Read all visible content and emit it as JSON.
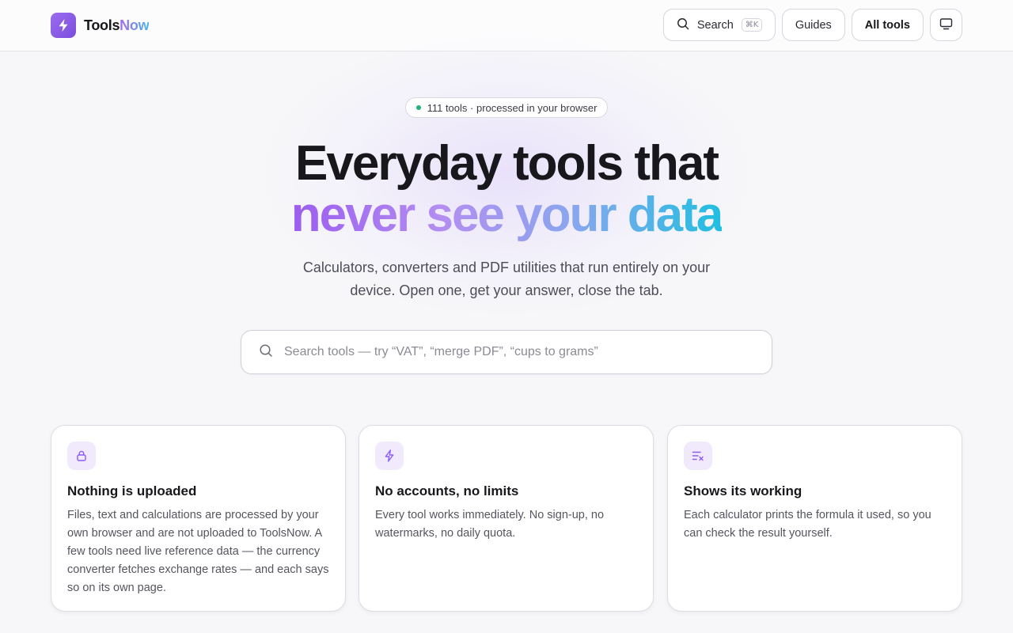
{
  "brand": {
    "name_part1": "Tools",
    "name_part2": "Now"
  },
  "nav": {
    "search_label": "Search",
    "search_shortcut": "⌘K",
    "guides_label": "Guides",
    "all_tools_label": "All tools"
  },
  "hero": {
    "badge": "111 tools · processed in your browser",
    "headline_line1": "Everyday tools that",
    "headline_line2": "never see your data",
    "subtitle": "Calculators, converters and PDF utilities that run entirely on your device. Open one, get your answer, close the tab."
  },
  "search": {
    "placeholder": "Search tools — try “VAT”, “merge PDF”, “cups to grams”",
    "value": ""
  },
  "features": [
    {
      "icon": "lock-icon",
      "title": "Nothing is uploaded",
      "body": "Files, text and calculations are processed by your own browser and are not uploaded to ToolsNow. A few tools need live reference data — the currency converter fetches exchange rates — and each says so on its own page."
    },
    {
      "icon": "bolt-icon",
      "title": "No accounts, no limits",
      "body": "Every tool works immediately. No sign-up, no watermarks, no daily quota."
    },
    {
      "icon": "formula-icon",
      "title": "Shows its working",
      "body": "Each calculator prints the formula it used, so you can check the result yourself."
    }
  ],
  "colors": {
    "accent": "#8b5cf6",
    "accent_light": "#f1eafd",
    "gradient_start": "#9b5df0",
    "gradient_end": "#20bfe0",
    "status_dot": "#22b07d"
  }
}
